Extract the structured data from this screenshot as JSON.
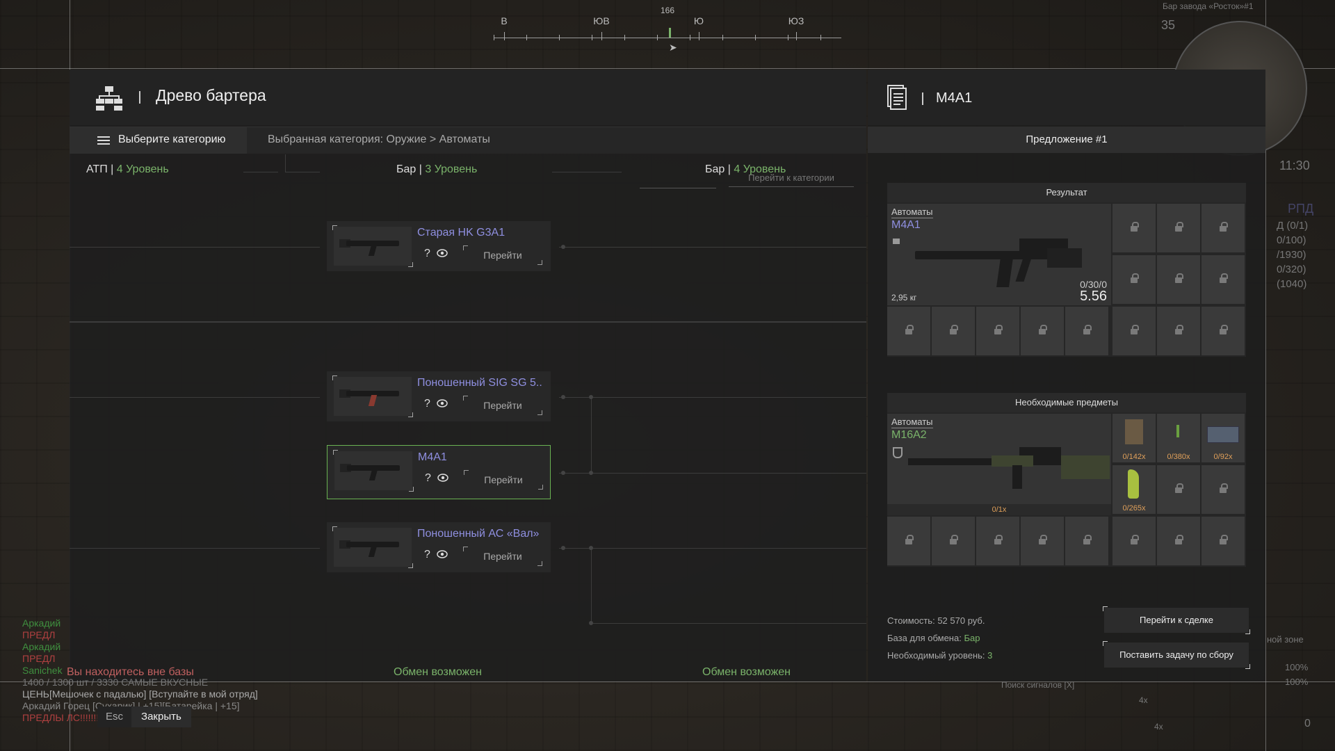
{
  "compass": {
    "heading": "166",
    "labels": [
      {
        "text": "В",
        "pos": 15
      },
      {
        "text": "ЮВ",
        "pos": 155
      },
      {
        "text": "Ю",
        "pos": 295
      },
      {
        "text": "ЮЗ",
        "pos": 435
      }
    ]
  },
  "hud": {
    "zone_name": "Бар завода «Росток»#1",
    "number": "35",
    "time": "11:30",
    "weapon": "РПД",
    "ammo_lines": [
      "Д (0/1)",
      "0/100)",
      "/1930)",
      "0/320)",
      "(1040)"
    ],
    "zone_status": "ной зоне",
    "pct1": "100%",
    "pct2": "100%",
    "signal_search": "Поиск сигналов [X]",
    "slot_counts": [
      "4x",
      "4x"
    ],
    "zero": "0"
  },
  "barter": {
    "title": "Древо бартера",
    "category_button": "Выберите категорию",
    "breadcrumb": "Выбранная категория: Оружие > Автоматы",
    "columns": [
      {
        "trader": "АТП",
        "level": "4 Уровень"
      },
      {
        "trader": "Бар",
        "level": "3 Уровень"
      },
      {
        "trader": "Бар",
        "level": "4 Уровень"
      }
    ],
    "partial_text": "Перейти к категории",
    "cards": [
      {
        "name": "Старая HK G3A1",
        "go": "Перейти"
      },
      {
        "name": "Поношенный SIG SG 5..",
        "go": "Перейти"
      },
      {
        "name": "M4A1",
        "go": "Перейти"
      },
      {
        "name": "Поношенный АС «Вал»",
        "go": "Перейти"
      }
    ],
    "question": "?",
    "footer": {
      "outside_base": "Вы находитесь вне базы",
      "exchange1": "Обмен возможен",
      "exchange2": "Обмен возможен"
    }
  },
  "detail": {
    "title": "M4A1",
    "offer_tab": "Предложение #1",
    "result": {
      "section": "Результат",
      "category": "Автоматы",
      "name": "M4A1",
      "weight": "2,95 кг",
      "ammo": "0/30/0",
      "caliber": "5.56"
    },
    "required": {
      "section": "Необходимые предметы",
      "category": "Автоматы",
      "name": "M16A2",
      "main_count": "0/1x",
      "counts": [
        "0/142x",
        "0/380x",
        "0/92x",
        "0/265x"
      ]
    },
    "cost_label": "Стоимость:",
    "cost_value": "52 570 руб.",
    "base_label": "База для обмена:",
    "base_value": "Бар",
    "level_label": "Необходимый уровень:",
    "level_value": "3",
    "deal_button": "Перейти к сделке",
    "task_button": "Поставить задачу по сбору"
  },
  "chat": [
    {
      "text": "Аркадий",
      "color": "#3f8f3f"
    },
    {
      "text": "ПРЕДЛ",
      "color": "#b04040"
    },
    {
      "text": "Аркадий",
      "color": "#3f8f3f"
    },
    {
      "text": "ПРЕДЛ",
      "color": "#b04040"
    },
    {
      "text": "Sanichek",
      "color": "#3f8f3f"
    },
    {
      "text": "1400 / 1300 шт / 3330 САМЫЕ ВКУСНЫЕ",
      "color": "#777"
    },
    {
      "text": "ЦЕНЬ[Мешочек с падалью] [Вступайте в мой отряд]",
      "color": "#aaa"
    },
    {
      "text": "Аркадий Горец [Сухарик] | +15][Батарейка | +15]",
      "color": "#888"
    },
    {
      "text": "ПРЕДЛЫ ЛС!!!!!!!!!!!!!!!!!!!!!!!!!!!!!!!",
      "color": "#b04040"
    }
  ],
  "esc": {
    "key": "Esc",
    "label": "Закрыть"
  }
}
